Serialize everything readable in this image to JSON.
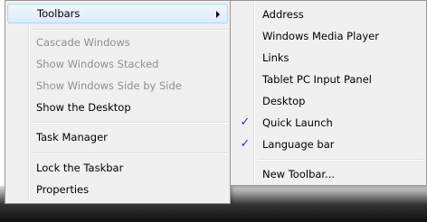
{
  "main_menu": {
    "items": [
      {
        "label": "Toolbars",
        "state": "highlighted",
        "submenu": true
      },
      {
        "label": "Cascade Windows",
        "state": "disabled"
      },
      {
        "label": "Show Windows Stacked",
        "state": "disabled"
      },
      {
        "label": "Show Windows Side by Side",
        "state": "disabled"
      },
      {
        "label": "Show the Desktop",
        "state": "enabled"
      },
      {
        "label": "Task Manager",
        "state": "enabled"
      },
      {
        "label": "Lock the Taskbar",
        "state": "enabled"
      },
      {
        "label": "Properties",
        "state": "enabled"
      }
    ]
  },
  "toolbars_submenu": {
    "items": [
      {
        "label": "Address",
        "checked": false
      },
      {
        "label": "Windows Media Player",
        "checked": false
      },
      {
        "label": "Links",
        "checked": false
      },
      {
        "label": "Tablet PC Input Panel",
        "checked": false
      },
      {
        "label": "Desktop",
        "checked": false
      },
      {
        "label": "Quick Launch",
        "checked": true
      },
      {
        "label": "Language bar",
        "checked": true
      },
      {
        "label": "New Toolbar...",
        "checked": false
      }
    ],
    "check_glyph": "✓"
  },
  "icons": [
    "chevron-right-icon",
    "checkmark-icon"
  ],
  "colors": {
    "menu_bg": "#f0f0f0",
    "highlight_border": "#a8d8f8",
    "disabled_text": "#8f8f8f",
    "check": "#1c3f96",
    "taskbar": "#1a1a1a"
  }
}
